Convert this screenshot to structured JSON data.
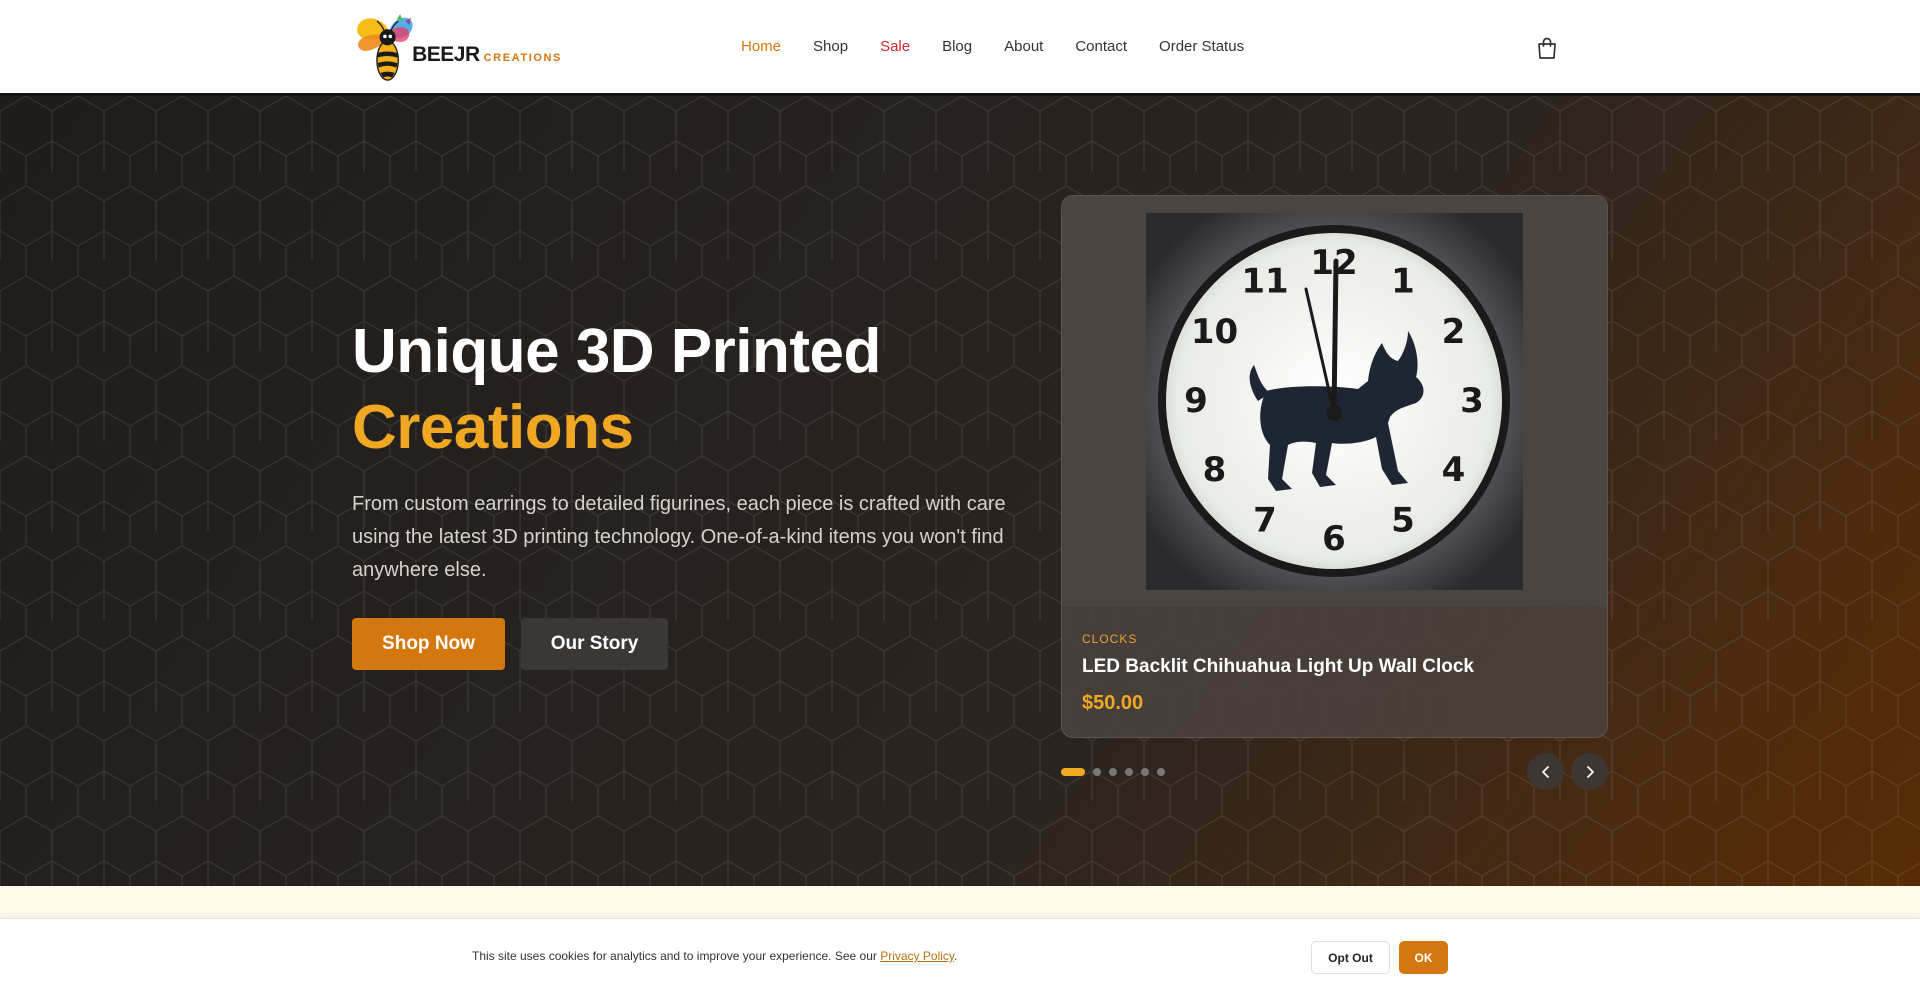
{
  "brand": {
    "name": "BEEJR",
    "tagline": "CREATIONS"
  },
  "nav": {
    "items": [
      {
        "label": "Home",
        "state": "active"
      },
      {
        "label": "Shop",
        "state": ""
      },
      {
        "label": "Sale",
        "state": "sale"
      },
      {
        "label": "Blog",
        "state": ""
      },
      {
        "label": "About",
        "state": ""
      },
      {
        "label": "Contact",
        "state": ""
      },
      {
        "label": "Order Status",
        "state": ""
      }
    ],
    "cart_icon": "shopping-bag-icon"
  },
  "hero": {
    "title_line1": "Unique 3D Printed",
    "title_line2": "Creations",
    "description": "From custom earrings to detailed figurines, each piece is crafted with care using the latest 3D printing technology. One-of-a-kind items you won't find anywhere else.",
    "primary_button": "Shop Now",
    "secondary_button": "Our Story"
  },
  "carousel": {
    "slide_count": 6,
    "active_index": 0,
    "product": {
      "category": "CLOCKS",
      "title": "LED Backlit Chihuahua Light Up Wall Clock",
      "price": "$50.00",
      "clock_numbers": [
        "12",
        "1",
        "2",
        "3",
        "4",
        "5",
        "6",
        "7",
        "8",
        "9",
        "10",
        "11"
      ]
    },
    "prev_icon": "chevron-left-icon",
    "next_icon": "chevron-right-icon"
  },
  "cookie": {
    "text": "This site uses cookies for analytics and to improve your experience. See our",
    "link": "Privacy Policy",
    "suffix": ".",
    "opt_out": "Opt Out",
    "ok": "OK"
  },
  "colors": {
    "accent": "#d4770e",
    "accent_light": "#f0a823",
    "sale": "#d42630",
    "hero_dark": "#1f1c1b"
  }
}
